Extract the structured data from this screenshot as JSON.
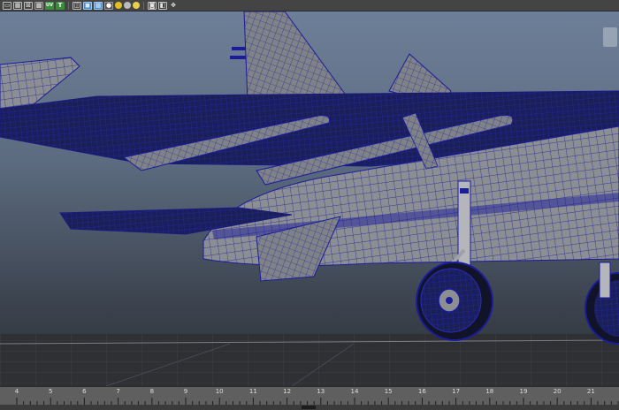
{
  "toolbar": {
    "buttons": [
      {
        "name": "select-mode-icon",
        "glyph": "▭"
      },
      {
        "name": "grid-mode-icon",
        "glyph": "▦"
      },
      {
        "name": "wireframe-icon",
        "glyph": "⊠"
      },
      {
        "name": "checker-icon",
        "glyph": "▩"
      },
      {
        "name": "uv-icon",
        "glyph": "UV"
      },
      {
        "name": "text-icon",
        "glyph": "T"
      },
      {
        "name": "cube-outline-icon",
        "glyph": "◫"
      },
      {
        "name": "cube-solid-icon",
        "glyph": "◼"
      },
      {
        "name": "checkerboard-icon",
        "glyph": "▦"
      },
      {
        "name": "light-icon",
        "glyph": "●"
      },
      {
        "name": "shaded-sphere-icon",
        "glyph": "●"
      },
      {
        "name": "gray-sphere-icon",
        "glyph": "●"
      },
      {
        "name": "camera-icon",
        "glyph": "◙"
      },
      {
        "name": "layer-icon",
        "glyph": "◧"
      },
      {
        "name": "tools-icon",
        "glyph": "✥"
      }
    ]
  },
  "viewport": {
    "background_top": "#6d7f98",
    "background_bottom": "#2c3036",
    "wire_color": "#1b1c9c",
    "surface_color": "#8a8d92"
  },
  "timeslider": {
    "frames": [
      "4",
      "5",
      "6",
      "7",
      "8",
      "9",
      "10",
      "11",
      "12",
      "13",
      "14",
      "15",
      "16",
      "17",
      "18",
      "19",
      "20",
      "21"
    ]
  }
}
